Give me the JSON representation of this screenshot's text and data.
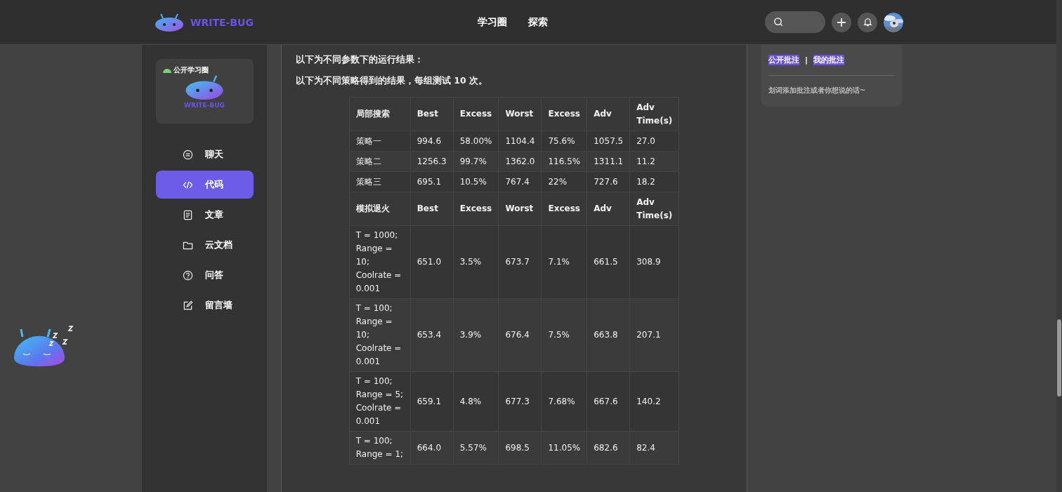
{
  "header": {
    "brand": "WRITE-BUG",
    "nav": [
      {
        "label": "学习圈",
        "selected": false
      },
      {
        "label": "探索",
        "selected": false
      }
    ]
  },
  "sidebar": {
    "card": {
      "badge": "公开学习圈",
      "brand": "WRITE-BUG"
    },
    "items": [
      {
        "label": "聊天",
        "selected": false
      },
      {
        "label": "代码",
        "selected": true
      },
      {
        "label": "文章",
        "selected": false
      },
      {
        "label": "云文档",
        "selected": false
      },
      {
        "label": "问答",
        "selected": false
      },
      {
        "label": "留言墙",
        "selected": false
      }
    ]
  },
  "article": {
    "paragraphs": [
      "以下为不同参数下的运行结果：",
      "以下为不同策略得到的结果，每组测试 10 次。"
    ],
    "table": {
      "rows": [
        {
          "kind": "header",
          "cells": [
            "局部搜索",
            "Best",
            "Excess",
            "Worst",
            "Excess",
            "Adv",
            "Adv Time(s)"
          ]
        },
        {
          "kind": "data",
          "cells": [
            "策略一",
            "994.6",
            "58.00%",
            "1104.4",
            "75.6%",
            "1057.5",
            "27.0"
          ]
        },
        {
          "kind": "data",
          "cells": [
            "策略二",
            "1256.3",
            "99.7%",
            "1362.0",
            "116.5%",
            "1311.1",
            "11.2"
          ]
        },
        {
          "kind": "data",
          "cells": [
            "策略三",
            "695.1",
            "10.5%",
            "767.4",
            "22%",
            "727.6",
            "18.2"
          ]
        },
        {
          "kind": "header",
          "cells": [
            "模拟退火",
            "Best",
            "Excess",
            "Worst",
            "Excess",
            "Adv",
            "Adv Time(s)"
          ]
        },
        {
          "kind": "data",
          "cells": [
            "T = 1000; Range = 10; Coolrate = 0.001",
            "651.0",
            "3.5%",
            "673.7",
            "7.1%",
            "661.5",
            "308.9"
          ]
        },
        {
          "kind": "data",
          "cells": [
            "T = 100; Range = 10; Coolrate = 0.001",
            "653.4",
            "3.9%",
            "676.4",
            "7.5%",
            "663.8",
            "207.1"
          ]
        },
        {
          "kind": "data",
          "cells": [
            "T = 100; Range = 5; Coolrate = 0.001",
            "659.1",
            "4.8%",
            "677.3",
            "7.68%",
            "667.6",
            "140.2"
          ]
        },
        {
          "kind": "data",
          "cells": [
            "T = 100; Range = 1;",
            "664.0",
            "5.57%",
            "698.5",
            "11.05%",
            "682.6",
            "82.4"
          ]
        }
      ]
    }
  },
  "annotations": {
    "tabs": [
      {
        "label": "公开批注",
        "selected": true
      },
      {
        "label": "我的批注",
        "selected": true
      }
    ],
    "separator": "|",
    "hint": "划词添加批注或者你想说的话~"
  }
}
